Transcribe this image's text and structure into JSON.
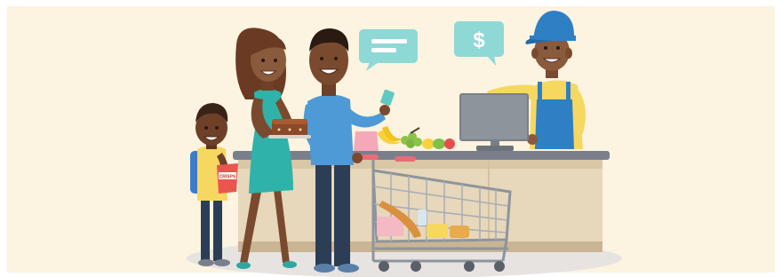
{
  "scene": {
    "background_color": "#FCF3E0",
    "floor_shadow_color": "#E6E3E1",
    "speech_bubble_color": "#8ED8D6"
  },
  "speech_bubbles": {
    "left": {
      "icon": "lines-icon"
    },
    "right": {
      "icon": "dollar-icon",
      "text": "$"
    }
  },
  "props": {
    "chip_bag_label": "CRISPS"
  }
}
